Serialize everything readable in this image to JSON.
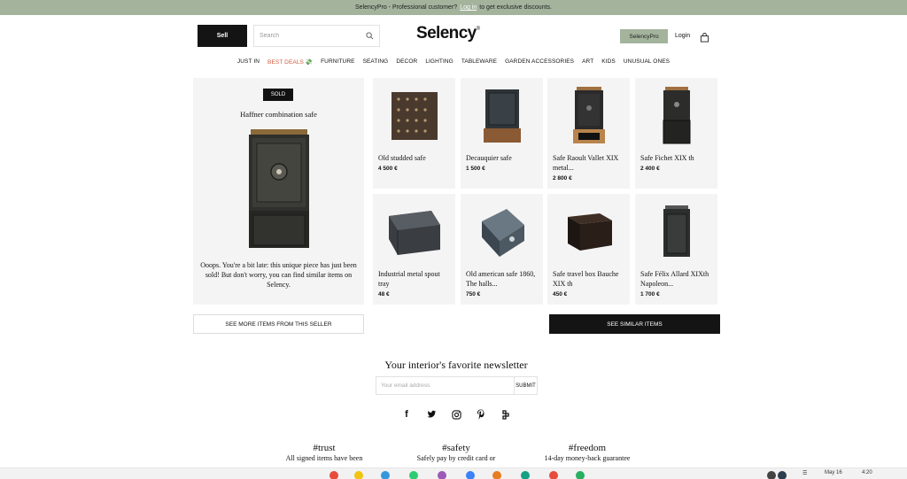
{
  "topbar": {
    "text_before": "SelencyPro - Professional customer?",
    "link": "Log in",
    "text_after": "to get exclusive discounts."
  },
  "header": {
    "sell_label": "Sell",
    "search_placeholder": "Search",
    "logo": "Selency",
    "logo_mark": "®",
    "pro_label": "SelencyPro",
    "login_label": "Login"
  },
  "nav": [
    "JUST IN",
    "BEST DEALS 💸",
    "FURNITURE",
    "SEATING",
    "DECOR",
    "LIGHTING",
    "TABLEWARE",
    "GARDEN ACCESSORIES",
    "ART",
    "KIDS",
    "UNUSUAL ONES"
  ],
  "sold_item": {
    "badge": "SOLD",
    "title": "Haffner combination safe",
    "message": "Ooops. You're a bit late: this unique piece has just been sold! But don't worry, you can find similar items on Selency."
  },
  "products": [
    {
      "name": "Old studded safe",
      "price": "4 500 €"
    },
    {
      "name": "Decauquier safe",
      "price": "1 500 €"
    },
    {
      "name": "Safe Raoult Vallet XIX metal...",
      "price": "2 800 €"
    },
    {
      "name": "Safe Fichet XIX th",
      "price": "2 400 €"
    },
    {
      "name": "Industrial metal spout tray",
      "price": "48 €"
    },
    {
      "name": "Old american safe 1860, The halls...",
      "price": "750 €"
    },
    {
      "name": "Safe travel box Bauche XIX th",
      "price": "450 €"
    },
    {
      "name": "Safe Félix Allard XIXth Napoleon...",
      "price": "1 700 €"
    }
  ],
  "buttons": {
    "seller": "SEE MORE ITEMS FROM THIS SELLER",
    "similar": "SEE SIMILAR ITEMS"
  },
  "newsletter": {
    "title": "Your interior's favorite newsletter",
    "placeholder": "Your email address",
    "submit": "SUBMIT"
  },
  "socials": [
    "facebook-icon",
    "twitter-icon",
    "instagram-icon",
    "pinterest-icon",
    "selency-app-icon"
  ],
  "values": [
    {
      "title": "#trust",
      "desc": "All signed items have been"
    },
    {
      "title": "#safety",
      "desc": "Safely pay by credit card or"
    },
    {
      "title": "#freedom",
      "desc": "14-day money-back guarantee"
    }
  ],
  "taskbar": {
    "date": "May 16",
    "time": "4:20"
  },
  "colors": {
    "accent_green": "#a3b39c",
    "deal_red": "#d25a3c",
    "dark": "#141414"
  }
}
